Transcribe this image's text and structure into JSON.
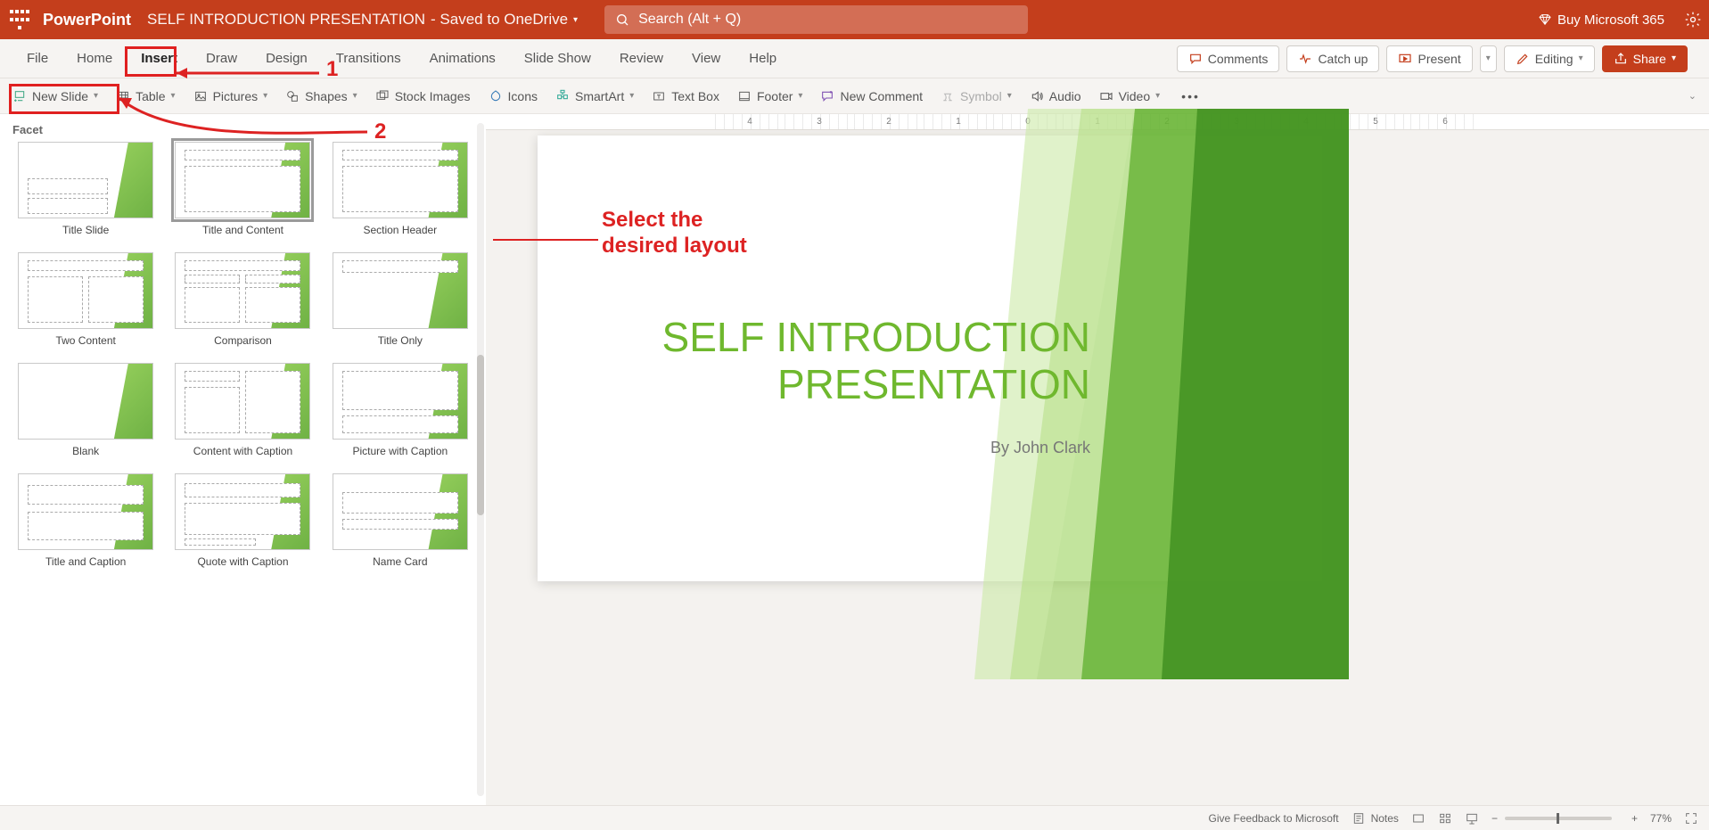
{
  "app": {
    "name": "PowerPoint",
    "doc_title": "SELF INTRODUCTION PRESENTATION",
    "saved_label": " - Saved to OneDrive",
    "search_placeholder": "Search (Alt + Q)",
    "buy_label": "Buy Microsoft 365"
  },
  "tabs": {
    "file": "File",
    "home": "Home",
    "insert": "Insert",
    "draw": "Draw",
    "design": "Design",
    "transitions": "Transitions",
    "animations": "Animations",
    "slideshow": "Slide Show",
    "review": "Review",
    "view": "View",
    "help": "Help"
  },
  "actions": {
    "comments": "Comments",
    "catchup": "Catch up",
    "present": "Present",
    "editing": "Editing",
    "share": "Share"
  },
  "ribbon": {
    "new_slide": "New Slide",
    "table": "Table",
    "pictures": "Pictures",
    "shapes": "Shapes",
    "stock_images": "Stock Images",
    "icons": "Icons",
    "smartart": "SmartArt",
    "textbox": "Text Box",
    "footer": "Footer",
    "new_comment": "New Comment",
    "symbol": "Symbol",
    "audio": "Audio",
    "video": "Video"
  },
  "gallery": {
    "theme_name": "Facet",
    "layouts": [
      "Title Slide",
      "Title and Content",
      "Section Header",
      "Two Content",
      "Comparison",
      "Title Only",
      "Blank",
      "Content with Caption",
      "Picture with Caption",
      "Title and Caption",
      "Quote with Caption",
      "Name Card"
    ],
    "selected_index": 1
  },
  "slide": {
    "title_line1": "SELF INTRODUCTION",
    "title_line2": "PRESENTATION",
    "subtitle": "By John Clark"
  },
  "annotations": {
    "step1": "1",
    "step2": "2",
    "select_line1": "Select the",
    "select_line2": "desired layout"
  },
  "status": {
    "feedback": "Give Feedback to Microsoft",
    "notes": "Notes",
    "zoom": "77%"
  },
  "ruler_ticks": [
    "4",
    "3",
    "2",
    "1",
    "0",
    "1",
    "2",
    "3",
    "4",
    "5",
    "6"
  ]
}
